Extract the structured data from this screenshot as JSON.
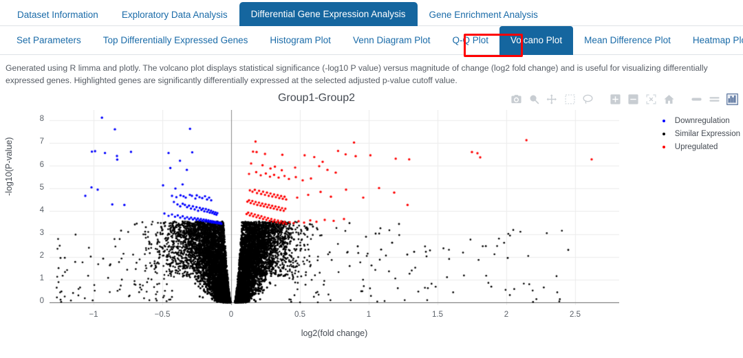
{
  "top_tabs": [
    {
      "label": "Dataset Information",
      "active": false
    },
    {
      "label": "Exploratory Data Analysis",
      "active": false
    },
    {
      "label": "Differential Gene Expression Analysis",
      "active": true
    },
    {
      "label": "Gene Enrichment Analysis",
      "active": false
    }
  ],
  "sub_tabs": [
    {
      "label": "Set Parameters",
      "active": false
    },
    {
      "label": "Top Differentially Expressed Genes",
      "active": false
    },
    {
      "label": "Histogram Plot",
      "active": false
    },
    {
      "label": "Venn Diagram Plot",
      "active": false
    },
    {
      "label": "Q-Q Plot",
      "active": false
    },
    {
      "label": "Volcano Plot",
      "active": true
    },
    {
      "label": "Mean Difference Plot",
      "active": false
    },
    {
      "label": "Heatmap Plot",
      "active": false
    }
  ],
  "highlight": {
    "color": "#ff0000",
    "target": "Volcano Plot"
  },
  "description": "Generated using R limma and plotly. The volcano plot displays statistical significance (-log10 P value) versus magnitude of change (log2 fold change) and is useful for visualizing differentially expressed genes. Highlighted genes are significantly differentially expressed at the selected adjusted p-value cutoff value.",
  "modebar": [
    {
      "name": "camera-icon",
      "title": "Download plot as a png"
    },
    {
      "name": "zoom-box-icon",
      "title": "Zoom"
    },
    {
      "name": "pan-icon",
      "title": "Pan"
    },
    {
      "name": "box-select-icon",
      "title": "Box Select"
    },
    {
      "name": "lasso-select-icon",
      "title": "Lasso Select"
    },
    {
      "name": "zoom-in-icon",
      "title": "Zoom in"
    },
    {
      "name": "zoom-out-icon",
      "title": "Zoom out"
    },
    {
      "name": "autoscale-icon",
      "title": "Autoscale"
    },
    {
      "name": "home-reset-axes-icon",
      "title": "Reset axes"
    },
    {
      "name": "toggle-spike-lines-icon",
      "title": "Toggle Spike Lines"
    },
    {
      "name": "hover-compare-icon",
      "title": "Show closest data on hover"
    },
    {
      "name": "plotly-logo-icon",
      "title": "Produced with Plotly"
    }
  ],
  "theme": {
    "tab_active_bg": "#15669f",
    "tab_link_color": "#1a6ba8",
    "downregulation_color": "#0000ff",
    "similar_color": "#000000",
    "upregulated_color": "#ff0000",
    "grid_color": "#ebebeb",
    "axis_color": "#666666"
  },
  "chart_data": {
    "type": "scatter",
    "title": "Group1-Group2",
    "xlabel": "log2(fold change)",
    "ylabel": "-log10(P-value)",
    "xlim": [
      -1.32,
      2.82
    ],
    "ylim": [
      -0.12,
      8.45
    ],
    "xticks": [
      -1,
      -0.5,
      0,
      0.5,
      1,
      1.5,
      2,
      2.5
    ],
    "xtick_labels": [
      "−1",
      "−0.5",
      "0",
      "0.5",
      "1",
      "1.5",
      "2",
      "2.5"
    ],
    "yticks": [
      0,
      1,
      2,
      3,
      4,
      5,
      6,
      7,
      8
    ],
    "ytick_labels": [
      "0",
      "1",
      "2",
      "3",
      "4",
      "5",
      "6",
      "7",
      "8"
    ],
    "grid": true,
    "legend_position": "top-right",
    "legend": [
      "Downregulation",
      "Similar Expression",
      "Upregulated"
    ],
    "series": [
      {
        "name": "Downregulation",
        "color": "#0000ff",
        "marker_size": 3,
        "points": [
          [
            -0.939,
            8.11
          ],
          [
            -0.845,
            7.6
          ],
          [
            -0.299,
            7.62
          ],
          [
            -1.012,
            6.62
          ],
          [
            -0.989,
            6.64
          ],
          [
            -0.917,
            6.56
          ],
          [
            -0.83,
            6.43
          ],
          [
            -0.828,
            6.27
          ],
          [
            -0.728,
            6.61
          ],
          [
            -0.455,
            6.56
          ],
          [
            -0.372,
            6.22
          ],
          [
            -0.283,
            6.59
          ],
          [
            -0.442,
            5.9
          ],
          [
            -0.322,
            5.82
          ],
          [
            -1.015,
            5.05
          ],
          [
            -0.97,
            4.95
          ],
          [
            -0.495,
            5.14
          ],
          [
            -0.353,
            5.18
          ],
          [
            -0.405,
            5.0
          ],
          [
            -1.06,
            4.68
          ],
          [
            -0.864,
            4.3
          ],
          [
            -0.776,
            4.28
          ],
          [
            -0.43,
            4.68
          ],
          [
            -0.398,
            4.62
          ],
          [
            -0.368,
            4.7
          ],
          [
            -0.346,
            4.66
          ],
          [
            -0.33,
            4.6
          ],
          [
            -0.3,
            4.72
          ],
          [
            -0.285,
            4.68
          ],
          [
            -0.26,
            4.56
          ],
          [
            -0.25,
            4.7
          ],
          [
            -0.23,
            4.62
          ],
          [
            -0.21,
            4.58
          ],
          [
            -0.19,
            4.66
          ],
          [
            -0.175,
            4.52
          ],
          [
            -0.16,
            4.6
          ],
          [
            -0.145,
            4.48
          ],
          [
            -0.416,
            4.41
          ],
          [
            -0.39,
            4.3
          ],
          [
            -0.37,
            4.22
          ],
          [
            -0.352,
            4.33
          ],
          [
            -0.336,
            4.28
          ],
          [
            -0.32,
            4.18
          ],
          [
            -0.306,
            4.25
          ],
          [
            -0.292,
            4.12
          ],
          [
            -0.278,
            4.22
          ],
          [
            -0.265,
            4.08
          ],
          [
            -0.252,
            4.18
          ],
          [
            -0.24,
            4.02
          ],
          [
            -0.228,
            4.15
          ],
          [
            -0.216,
            4.06
          ],
          [
            -0.205,
            4.12
          ],
          [
            -0.195,
            4.0
          ],
          [
            -0.184,
            4.1
          ],
          [
            -0.174,
            3.98
          ],
          [
            -0.164,
            4.06
          ],
          [
            -0.155,
            3.94
          ],
          [
            -0.146,
            4.02
          ],
          [
            -0.138,
            3.92
          ],
          [
            -0.13,
            3.98
          ],
          [
            -0.122,
            3.88
          ],
          [
            -0.114,
            3.95
          ],
          [
            -0.107,
            3.85
          ],
          [
            -0.1,
            3.92
          ],
          [
            -0.485,
            3.9
          ],
          [
            -0.455,
            3.8
          ],
          [
            -0.43,
            3.86
          ],
          [
            -0.408,
            3.76
          ],
          [
            -0.388,
            3.82
          ],
          [
            -0.37,
            3.72
          ],
          [
            -0.352,
            3.78
          ],
          [
            -0.336,
            3.68
          ],
          [
            -0.32,
            3.74
          ],
          [
            -0.305,
            3.66
          ],
          [
            -0.291,
            3.72
          ],
          [
            -0.278,
            3.64
          ],
          [
            -0.265,
            3.7
          ],
          [
            -0.253,
            3.62
          ],
          [
            -0.242,
            3.68
          ],
          [
            -0.231,
            3.6
          ],
          [
            -0.22,
            3.66
          ],
          [
            -0.21,
            3.58
          ],
          [
            -0.2,
            3.64
          ],
          [
            -0.191,
            3.56
          ],
          [
            -0.182,
            3.62
          ],
          [
            -0.173,
            3.55
          ],
          [
            -0.165,
            3.6
          ],
          [
            -0.157,
            3.53
          ],
          [
            -0.149,
            3.58
          ],
          [
            -0.142,
            3.51
          ],
          [
            -0.135,
            3.56
          ],
          [
            -0.128,
            3.5
          ],
          [
            -0.121,
            3.54
          ],
          [
            -0.115,
            3.49
          ],
          [
            -0.109,
            3.53
          ],
          [
            -0.103,
            3.48
          ],
          [
            -0.097,
            3.52
          ],
          [
            -0.091,
            3.47
          ],
          [
            -0.086,
            3.5
          ],
          [
            -0.081,
            3.46
          ],
          [
            -0.076,
            3.49
          ],
          [
            -0.071,
            3.45
          ]
        ]
      },
      {
        "name": "Upregulated",
        "color": "#ff0000",
        "marker_size": 3,
        "points": [
          [
            0.177,
            7.06
          ],
          [
            0.893,
            7.02
          ],
          [
            2.146,
            7.12
          ],
          [
            0.159,
            6.62
          ],
          [
            0.185,
            6.6
          ],
          [
            0.246,
            6.52
          ],
          [
            0.372,
            6.48
          ],
          [
            0.534,
            6.46
          ],
          [
            0.604,
            6.38
          ],
          [
            0.665,
            6.17
          ],
          [
            1.196,
            6.31
          ],
          [
            1.294,
            6.28
          ],
          [
            1.75,
            6.6
          ],
          [
            1.79,
            6.55
          ],
          [
            1.81,
            6.37
          ],
          [
            2.62,
            6.28
          ],
          [
            0.145,
            6.1
          ],
          [
            0.228,
            6.02
          ],
          [
            0.286,
            5.88
          ],
          [
            0.318,
            5.96
          ],
          [
            0.368,
            5.8
          ],
          [
            0.465,
            5.92
          ],
          [
            0.777,
            6.65
          ],
          [
            0.832,
            6.5
          ],
          [
            0.905,
            6.42
          ],
          [
            1.012,
            6.46
          ],
          [
            1.282,
            4.28
          ],
          [
            0.13,
            5.64
          ],
          [
            0.182,
            5.72
          ],
          [
            0.215,
            5.58
          ],
          [
            0.252,
            5.66
          ],
          [
            0.282,
            5.52
          ],
          [
            0.312,
            5.6
          ],
          [
            0.345,
            5.48
          ],
          [
            0.388,
            5.55
          ],
          [
            0.42,
            5.42
          ],
          [
            0.47,
            5.5
          ],
          [
            0.52,
            5.36
          ],
          [
            0.58,
            5.44
          ],
          [
            0.64,
            5.98
          ],
          [
            0.7,
            5.82
          ],
          [
            0.76,
            5.7
          ],
          [
            0.136,
            4.92
          ],
          [
            0.155,
            4.86
          ],
          [
            0.172,
            4.94
          ],
          [
            0.188,
            4.8
          ],
          [
            0.203,
            4.9
          ],
          [
            0.218,
            4.76
          ],
          [
            0.232,
            4.86
          ],
          [
            0.246,
            4.72
          ],
          [
            0.26,
            4.82
          ],
          [
            0.273,
            4.68
          ],
          [
            0.286,
            4.78
          ],
          [
            0.299,
            4.65
          ],
          [
            0.312,
            4.74
          ],
          [
            0.325,
            4.62
          ],
          [
            0.338,
            4.71
          ],
          [
            0.35,
            4.58
          ],
          [
            0.363,
            4.67
          ],
          [
            0.375,
            4.55
          ],
          [
            0.388,
            4.64
          ],
          [
            0.4,
            4.52
          ],
          [
            0.118,
            4.42
          ],
          [
            0.13,
            4.48
          ],
          [
            0.142,
            4.36
          ],
          [
            0.154,
            4.45
          ],
          [
            0.166,
            4.32
          ],
          [
            0.178,
            4.41
          ],
          [
            0.19,
            4.28
          ],
          [
            0.202,
            4.38
          ],
          [
            0.214,
            4.25
          ],
          [
            0.226,
            4.34
          ],
          [
            0.238,
            4.22
          ],
          [
            0.25,
            4.31
          ],
          [
            0.262,
            4.18
          ],
          [
            0.274,
            4.28
          ],
          [
            0.286,
            4.15
          ],
          [
            0.298,
            4.24
          ],
          [
            0.31,
            4.12
          ],
          [
            0.322,
            4.21
          ],
          [
            0.334,
            4.08
          ],
          [
            0.346,
            4.18
          ],
          [
            0.358,
            4.05
          ],
          [
            0.37,
            4.14
          ],
          [
            0.382,
            4.02
          ],
          [
            0.394,
            4.11
          ],
          [
            0.112,
            3.88
          ],
          [
            0.124,
            3.94
          ],
          [
            0.136,
            3.82
          ],
          [
            0.148,
            3.9
          ],
          [
            0.16,
            3.78
          ],
          [
            0.172,
            3.86
          ],
          [
            0.184,
            3.74
          ],
          [
            0.196,
            3.82
          ],
          [
            0.208,
            3.7
          ],
          [
            0.22,
            3.78
          ],
          [
            0.232,
            3.66
          ],
          [
            0.244,
            3.74
          ],
          [
            0.256,
            3.62
          ],
          [
            0.268,
            3.7
          ],
          [
            0.28,
            3.58
          ],
          [
            0.292,
            3.66
          ],
          [
            0.304,
            3.55
          ],
          [
            0.316,
            3.62
          ],
          [
            0.328,
            3.52
          ],
          [
            0.34,
            3.59
          ],
          [
            0.352,
            3.49
          ],
          [
            0.364,
            3.56
          ],
          [
            0.376,
            3.47
          ],
          [
            0.388,
            3.53
          ],
          [
            0.4,
            3.45
          ],
          [
            0.425,
            3.52
          ],
          [
            0.455,
            3.48
          ],
          [
            0.49,
            3.56
          ],
          [
            0.53,
            3.5
          ],
          [
            0.575,
            3.6
          ],
          [
            0.62,
            3.54
          ],
          [
            0.68,
            3.62
          ],
          [
            0.745,
            3.58
          ],
          [
            0.82,
            3.66
          ],
          [
            0.48,
            4.6
          ],
          [
            0.56,
            4.72
          ],
          [
            0.65,
            4.85
          ],
          [
            0.725,
            4.64
          ],
          [
            0.835,
            4.95
          ],
          [
            0.96,
            4.6
          ],
          [
            1.075,
            5.02
          ],
          [
            1.185,
            4.82
          ]
        ]
      },
      {
        "name": "Similar Expression",
        "color": "#000000",
        "marker_size": 3,
        "description": "Dense bilobed cloud of non-significant genes centered at log2FC=0, spanning roughly -0.75..0.75 with long thin tails down to y=0 and outliers scattered to x=-1.25 and x=2.45 at low -log10(P) values."
      }
    ]
  }
}
